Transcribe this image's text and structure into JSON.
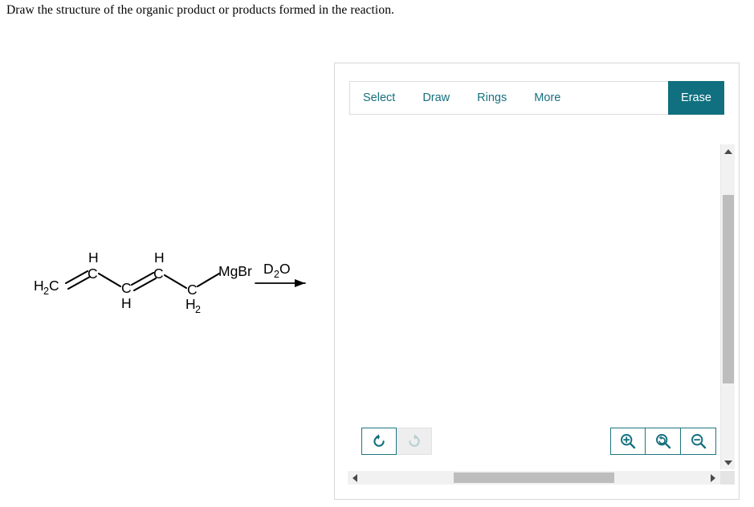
{
  "question": {
    "prompt": "Draw the structure of the organic product or products formed in the reaction."
  },
  "reaction": {
    "reagent_above_arrow": "D2O",
    "reagent_above_arrow_display": "D₂O",
    "reactant_formula": "H2C=CH-CH=CH-CH2-MgBr",
    "labels": {
      "h2c_left": "H",
      "h2c_left_sub": "2",
      "h2c_left_c": "C",
      "c2": "C",
      "c2_h": "H",
      "c3": "C",
      "c3_h": "H",
      "c4": "C",
      "c4_h": "H",
      "c5": "C",
      "c5_sub": "2",
      "mgbr": "MgBr"
    }
  },
  "editor": {
    "menu": [
      {
        "label": "Select",
        "name": "menu-select"
      },
      {
        "label": "Draw",
        "name": "menu-draw"
      },
      {
        "label": "Rings",
        "name": "menu-rings"
      },
      {
        "label": "More",
        "name": "menu-more"
      }
    ],
    "erase_label": "Erase",
    "accent_color": "#10707f",
    "disabled_color": "#b9cfd1",
    "canvas_content": "",
    "controls": {
      "undo": {
        "icon": "undo-icon",
        "enabled": true
      },
      "redo": {
        "icon": "redo-icon",
        "enabled": false
      },
      "zoom_in": {
        "icon": "zoom-in-icon",
        "enabled": true
      },
      "zoom_reset": {
        "icon": "zoom-reset-icon",
        "enabled": true
      },
      "zoom_out": {
        "icon": "zoom-out-icon",
        "enabled": true
      }
    },
    "scrollbars": {
      "vertical": {
        "icon_up": "triangle-up-icon",
        "icon_down": "triangle-down-icon"
      },
      "horizontal": {
        "icon_left": "triangle-left-icon",
        "icon_right": "triangle-right-icon"
      }
    }
  }
}
